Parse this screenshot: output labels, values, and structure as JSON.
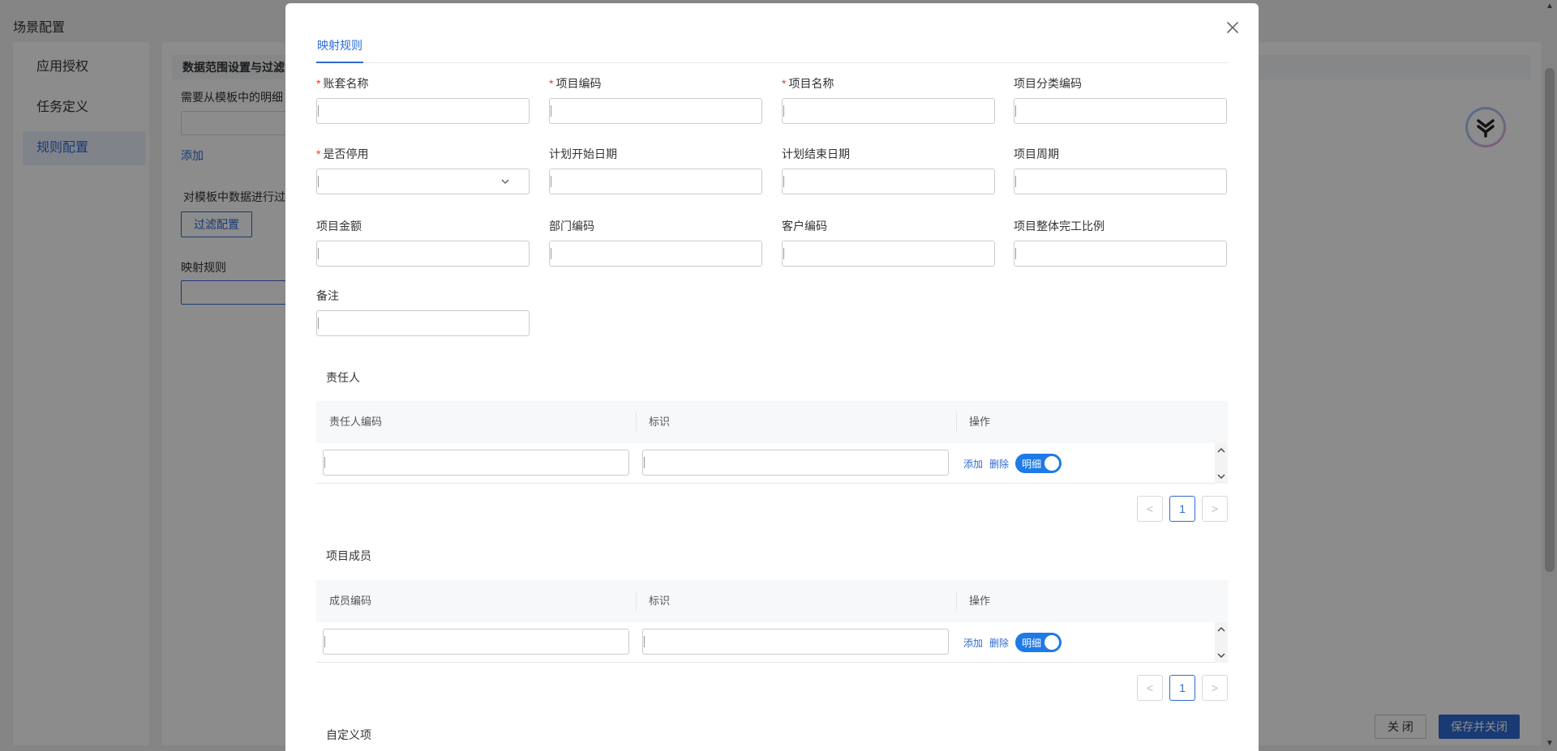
{
  "background": {
    "page_title": "场景配置",
    "nav": [
      "应用授权",
      "任务定义",
      "规则配置"
    ],
    "section_title": "数据范围设置与过滤",
    "detail_hint": "需要从模板中的明细",
    "add_link": "添加",
    "filter_hint": "对模板中数据进行过",
    "filter_button": "过滤配置",
    "mapping_label": "映射规则",
    "close_button": "关 闭",
    "save_button": "保存并关闭"
  },
  "modal": {
    "tab": "映射规则",
    "fields": [
      {
        "label": "账套名称",
        "required": true,
        "type": "text"
      },
      {
        "label": "项目编码",
        "required": true,
        "type": "text"
      },
      {
        "label": "项目名称",
        "required": true,
        "type": "text"
      },
      {
        "label": "项目分类编码",
        "required": false,
        "type": "text"
      },
      {
        "label": "是否停用",
        "required": true,
        "type": "select"
      },
      {
        "label": "计划开始日期",
        "required": false,
        "type": "text"
      },
      {
        "label": "计划结束日期",
        "required": false,
        "type": "text"
      },
      {
        "label": "项目周期",
        "required": false,
        "type": "text"
      },
      {
        "label": "项目金额",
        "required": false,
        "type": "text"
      },
      {
        "label": "部门编码",
        "required": false,
        "type": "text"
      },
      {
        "label": "客户编码",
        "required": false,
        "type": "text"
      },
      {
        "label": "项目整体完工比例",
        "required": false,
        "type": "text"
      },
      {
        "label": "备注",
        "required": false,
        "type": "text"
      }
    ],
    "required_mark": "*",
    "sections": [
      {
        "title": "责任人",
        "columns": [
          "责任人编码",
          "标识",
          "操作"
        ],
        "actions": {
          "add": "添加",
          "delete": "删除",
          "toggle": "明细"
        },
        "page": "1"
      },
      {
        "title": "项目成员",
        "columns": [
          "成员编码",
          "标识",
          "操作"
        ],
        "actions": {
          "add": "添加",
          "delete": "删除",
          "toggle": "明细"
        },
        "page": "1"
      }
    ],
    "custom_section_title": "自定义项",
    "pager_prev": "<",
    "pager_next": ">"
  },
  "colors": {
    "accent": "#2f6bd4",
    "toggle": "#1e7ae6",
    "required": "#e53935"
  }
}
